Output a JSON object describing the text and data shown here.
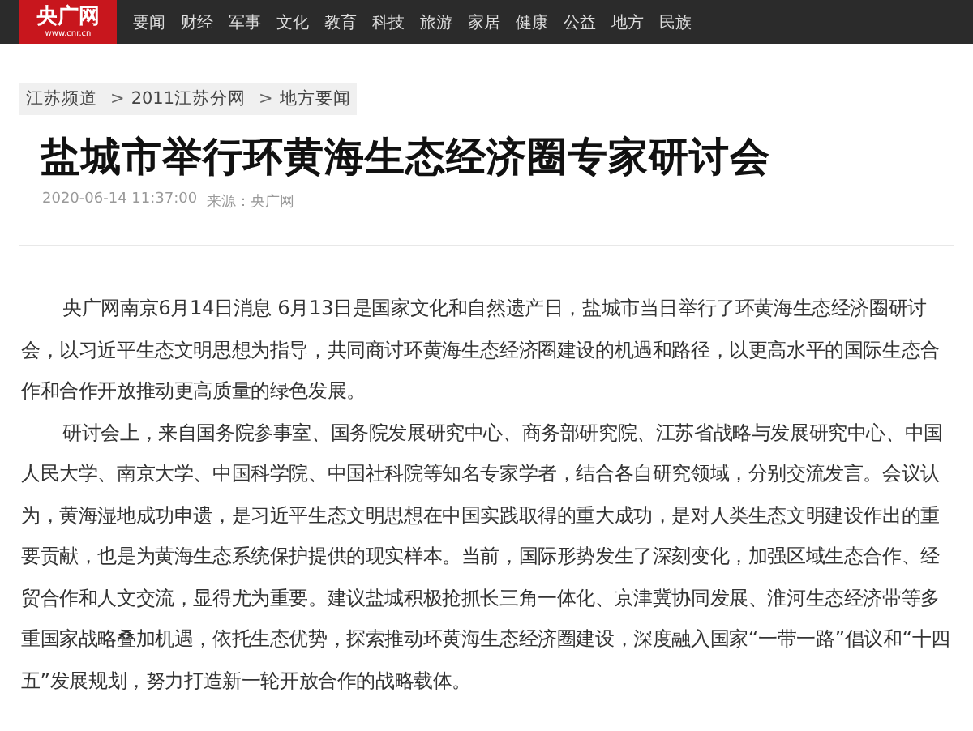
{
  "logo": {
    "name": "央广网",
    "url": "www.cnr.cn"
  },
  "nav": [
    "要闻",
    "财经",
    "军事",
    "文化",
    "教育",
    "科技",
    "旅游",
    "家居",
    "健康",
    "公益",
    "地方",
    "民族"
  ],
  "breadcrumb": [
    "江苏频道",
    "2011江苏分网",
    "地方要闻"
  ],
  "breadcrumb_separator": ">",
  "article": {
    "title": "盐城市举行环黄海生态经济圈专家研讨会",
    "date": "2020-06-14 11:37:00",
    "source_label": "来源：",
    "source": "央广网",
    "paragraphs": [
      "央广网南京6月14日消息 6月13日是国家文化和自然遗产日，盐城市当日举行了环黄海生态经济圈研讨会，以习近平生态文明思想为指导，共同商讨环黄海生态经济圈建设的机遇和路径，以更高水平的国际生态合作和合作开放推动更高质量的绿色发展。",
      "研讨会上，来自国务院参事室、国务院发展研究中心、商务部研究院、江苏省战略与发展研究中心、中国人民大学、南京大学、中国科学院、中国社科院等知名专家学者，结合各自研究领域，分别交流发言。会议认为，黄海湿地成功申遗，是习近平生态文明思想在中国实践取得的重大成功，是对人类生态文明建设作出的重要贡献，也是为黄海生态系统保护提供的现实样本。当前，国际形势发生了深刻变化，加强区域生态合作、经贸合作和人文交流，显得尤为重要。建议盐城积极抢抓长三角一体化、京津冀协同发展、淮河生态经济带等多重国家战略叠加机遇，依托生态优势，探索推动环黄海生态经济圈建设，深度融入国家“一带一路”倡议和“十四五”发展规划，努力打造新一轮开放合作的战略载体。"
    ]
  }
}
